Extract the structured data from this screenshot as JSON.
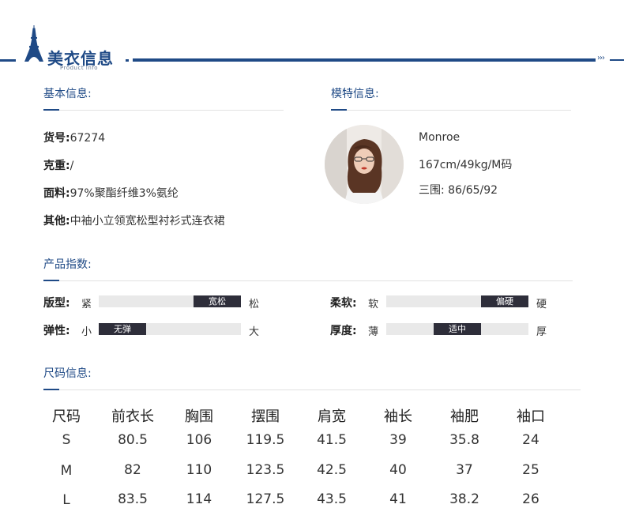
{
  "header": {
    "title": "美衣信息",
    "subtitle": "Product Info",
    "arrows": "›››"
  },
  "basic_info": {
    "title": "基本信息:",
    "rows": [
      {
        "key": "货号:",
        "value": "67274"
      },
      {
        "key": "克重:",
        "value": "/"
      },
      {
        "key": "面料:",
        "value": "97%聚酯纤维3%氨纶"
      },
      {
        "key": "其他:",
        "value": "中袖小立领宽松型衬衫式连衣裙"
      }
    ]
  },
  "model_info": {
    "title": "模特信息:",
    "name": "Monroe",
    "size": "167cm/49kg/M码",
    "measurements": "三围: 86/65/92"
  },
  "product_index": {
    "title": "产品指数:",
    "items": [
      {
        "label": "版型:",
        "left": "紧",
        "right": "松",
        "selected": "宽松",
        "level": 0.8
      },
      {
        "label": "柔软:",
        "left": "软",
        "right": "硬",
        "selected": "偏硬",
        "level": 0.8
      },
      {
        "label": "弹性:",
        "left": "小",
        "right": "大",
        "selected": "无弹",
        "level": 0.2
      },
      {
        "label": "厚度:",
        "left": "薄",
        "right": "厚",
        "selected": "适中",
        "level": 0.5
      }
    ]
  },
  "size_info": {
    "title": "尺码信息:",
    "headers": [
      "尺码",
      "前衣长",
      "胸围",
      "摆围",
      "肩宽",
      "袖长",
      "袖肥",
      "袖口"
    ],
    "rows": [
      [
        "S",
        "80.5",
        "106",
        "119.5",
        "41.5",
        "39",
        "35.8",
        "24"
      ],
      [
        "M",
        "82",
        "110",
        "123.5",
        "42.5",
        "40",
        "37",
        "25"
      ],
      [
        "L",
        "83.5",
        "114",
        "127.5",
        "43.5",
        "41",
        "38.2",
        "26"
      ]
    ]
  },
  "colors": {
    "accent": "#1f4a86",
    "bar_fill": "#2e2e3a",
    "bar_track": "#e9e9e9"
  },
  "icons": {
    "header": "eiffel-tower-icon"
  }
}
